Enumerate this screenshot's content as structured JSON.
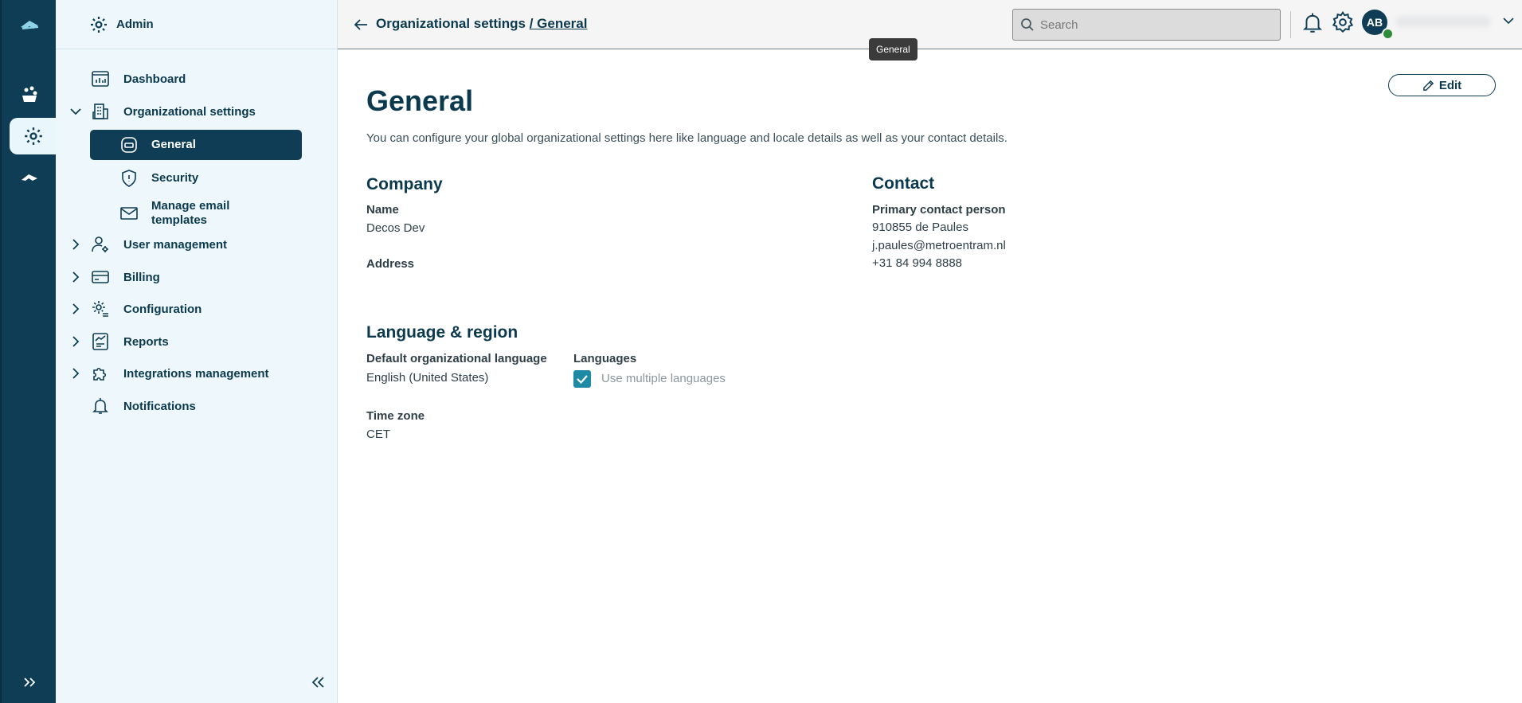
{
  "sidebar": {
    "title": "Admin",
    "items": [
      {
        "label": "Dashboard"
      },
      {
        "label": "Organizational settings"
      },
      {
        "label": "User management"
      },
      {
        "label": "Billing"
      },
      {
        "label": "Configuration"
      },
      {
        "label": "Reports"
      },
      {
        "label": "Integrations management"
      },
      {
        "label": "Notifications"
      }
    ],
    "sub_items": [
      {
        "label": "General"
      },
      {
        "label": "Security"
      },
      {
        "label": "Manage email templates"
      }
    ]
  },
  "header": {
    "breadcrumb_parent": "Organizational settings",
    "breadcrumb_current": "/ General",
    "tooltip": "General",
    "search_placeholder": "Search",
    "avatar_initials": "AB"
  },
  "page": {
    "title": "General",
    "edit_label": "Edit",
    "intro": "You can configure your global organizational settings here like language and locale details as well as your contact details."
  },
  "company": {
    "heading": "Company",
    "name_label": "Name",
    "name_value": "Decos Dev",
    "address_label": "Address"
  },
  "contact": {
    "heading": "Contact",
    "person_label": "Primary contact person",
    "person_name": "910855 de Paules",
    "email": "j.paules@metroentram.nl",
    "phone": "+31 84 994 8888"
  },
  "language": {
    "heading": "Language & region",
    "default_label": "Default organizational language",
    "default_value": "English (United States)",
    "languages_label": "Languages",
    "multiple_label": "Use multiple languages",
    "multiple_checked": true,
    "timezone_label": "Time zone",
    "timezone_value": "CET"
  },
  "colors": {
    "brand_dark": "#0e3d55",
    "sidebar_bg": "#eef8fc",
    "accent_teal": "#1e8aa6",
    "presence_green": "#2e8b3a"
  }
}
